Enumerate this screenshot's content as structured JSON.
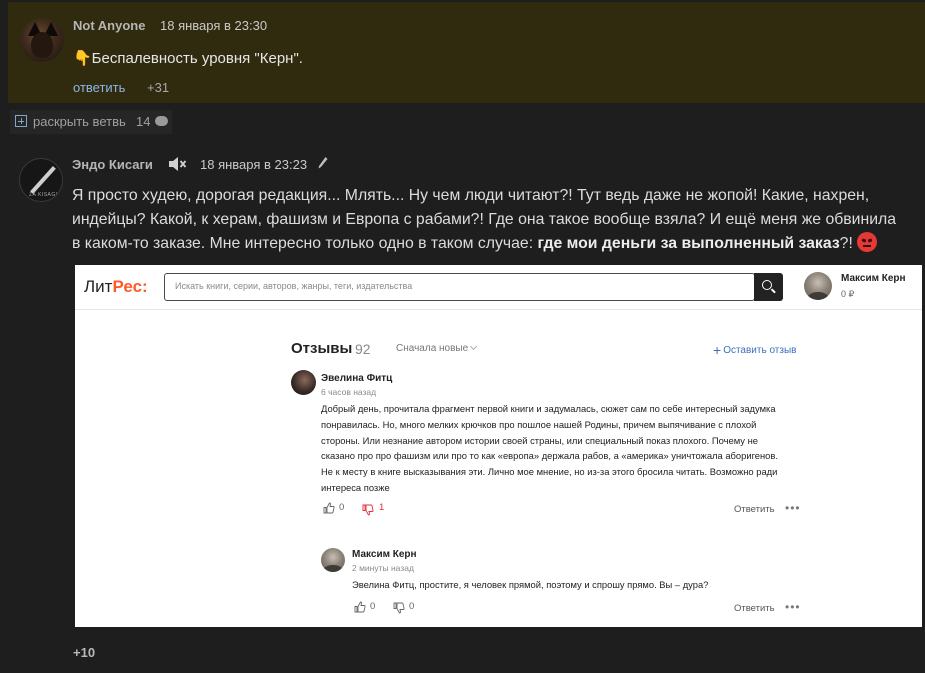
{
  "comment1": {
    "author": "Not Anyone",
    "date": "18 января в 23:30",
    "text": "👇Беспалевность уровня \"Керн\".",
    "reply_label": "ответить",
    "score": "+31"
  },
  "branch": {
    "label": "раскрыть ветвь",
    "count": "14"
  },
  "comment2": {
    "author": "Эндо Кисаги",
    "date": "18 января в 23:23",
    "text_plain": "Я просто худею, дорогая редакция... Млять... Ну чем люди читают?! Тут ведь даже не жопой! Какие, нахрен, индейцы? Какой, к херам, фашизм и Европа с рабами?! Где она такое вообще взяла? И ещё меня же обвинила в каком-то заказе. Мне интересно только одно в таком случае: ",
    "text_bold": "где мои деньги за выполненный заказ",
    "text_tail": "?!",
    "score": "+10"
  },
  "screenshot": {
    "logo_left": "Лит",
    "logo_right": "Рес:",
    "search_placeholder": "Искать книги, серии, авторов, жанры, теги, издательства",
    "user_name": "Максим Керн",
    "user_balance": "0 ₽",
    "reviews_title": "Отзывы",
    "reviews_count": "92",
    "sort_label": "Сначала новые",
    "add_review": "Оставить отзыв",
    "review1": {
      "author": "Эвелина Фитц",
      "time": "6 часов назад",
      "lines": [
        "Добрый день, прочитала фрагмент первой книги и задумалась, сюжет сам по себе интересный задумка",
        "понравилась. Но, много мелких крючков про пошлое нашей Родины, причем выпячивание с плохой",
        "стороны. Или незнание автором истории своей страны, или специальный показ плохого. Почему не",
        "сказано про про фашизм или про то как «европа» держала рабов, а «америка» уничтожала аборигенов.",
        "Не к месту в книге высказывания эти. Лично мое мнение, но из-за этого бросила читать. Возможно ради",
        "интереса позже"
      ],
      "likes": "0",
      "dislikes": "1",
      "reply_label": "Ответить",
      "more": "•••"
    },
    "review2": {
      "author": "Максим Керн",
      "time": "2 минуты назад",
      "text": "Эвелина Фитц, простите, я человек прямой, поэтому и спрошу прямо. Вы – дура?",
      "likes": "0",
      "dislikes": "0",
      "reply_label": "Ответить",
      "more": "•••"
    }
  },
  "colors": {
    "page_bg": "#1e1e1e",
    "highlight_bg": "#302b0e",
    "link_blue": "#8ab8e6",
    "litres_orange": "#ff5a28",
    "dislike_red": "#e0303a"
  }
}
